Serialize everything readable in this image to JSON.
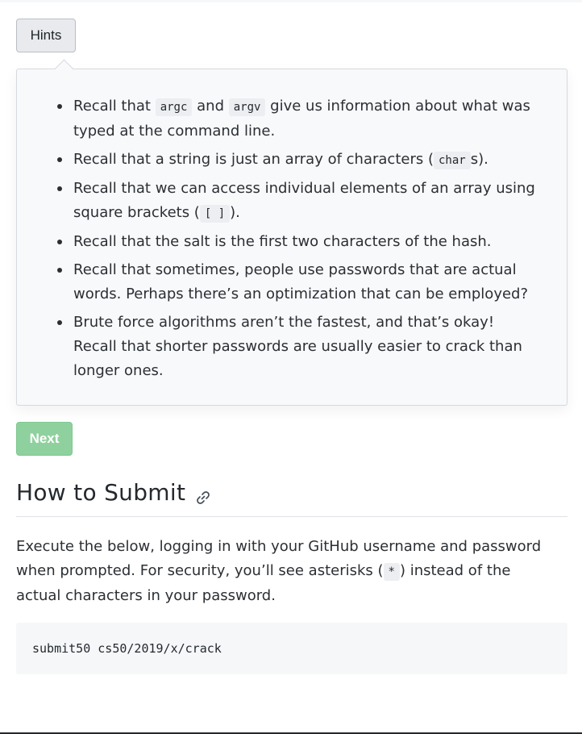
{
  "hints_button": {
    "label": "Hints"
  },
  "hints": [
    {
      "before": "Recall that ",
      "code1": "argc",
      "middle": " and ",
      "code2": "argv",
      "after": " give us information about what was typed at the command line."
    },
    {
      "before": "Recall that a string is just an array of characters (",
      "code": "char",
      "after": "s)."
    },
    {
      "before": "Recall that we can access individual elements of an array using square brackets (",
      "code": "[ ]",
      "after": ")."
    },
    {
      "text": "Recall that the salt is the first two characters of the hash."
    },
    {
      "text": "Recall that sometimes, people use passwords that are actual words. Perhaps there’s an optimization that can be employed?"
    },
    {
      "text": "Brute force algorithms aren’t the fastest, and that’s okay! Recall that shorter passwords are usually easier to crack than longer ones."
    }
  ],
  "next_button": {
    "label": "Next"
  },
  "section": {
    "title": "How to Submit",
    "instructions_before": "Execute the below, logging in with your GitHub username and password when prompted. For security, you’ll see asterisks (",
    "instructions_code": "*",
    "instructions_after": ") instead of the actual characters in your password.",
    "command": "submit50 cs50/2019/x/crack"
  },
  "icons": {
    "section_link": "link-icon"
  }
}
